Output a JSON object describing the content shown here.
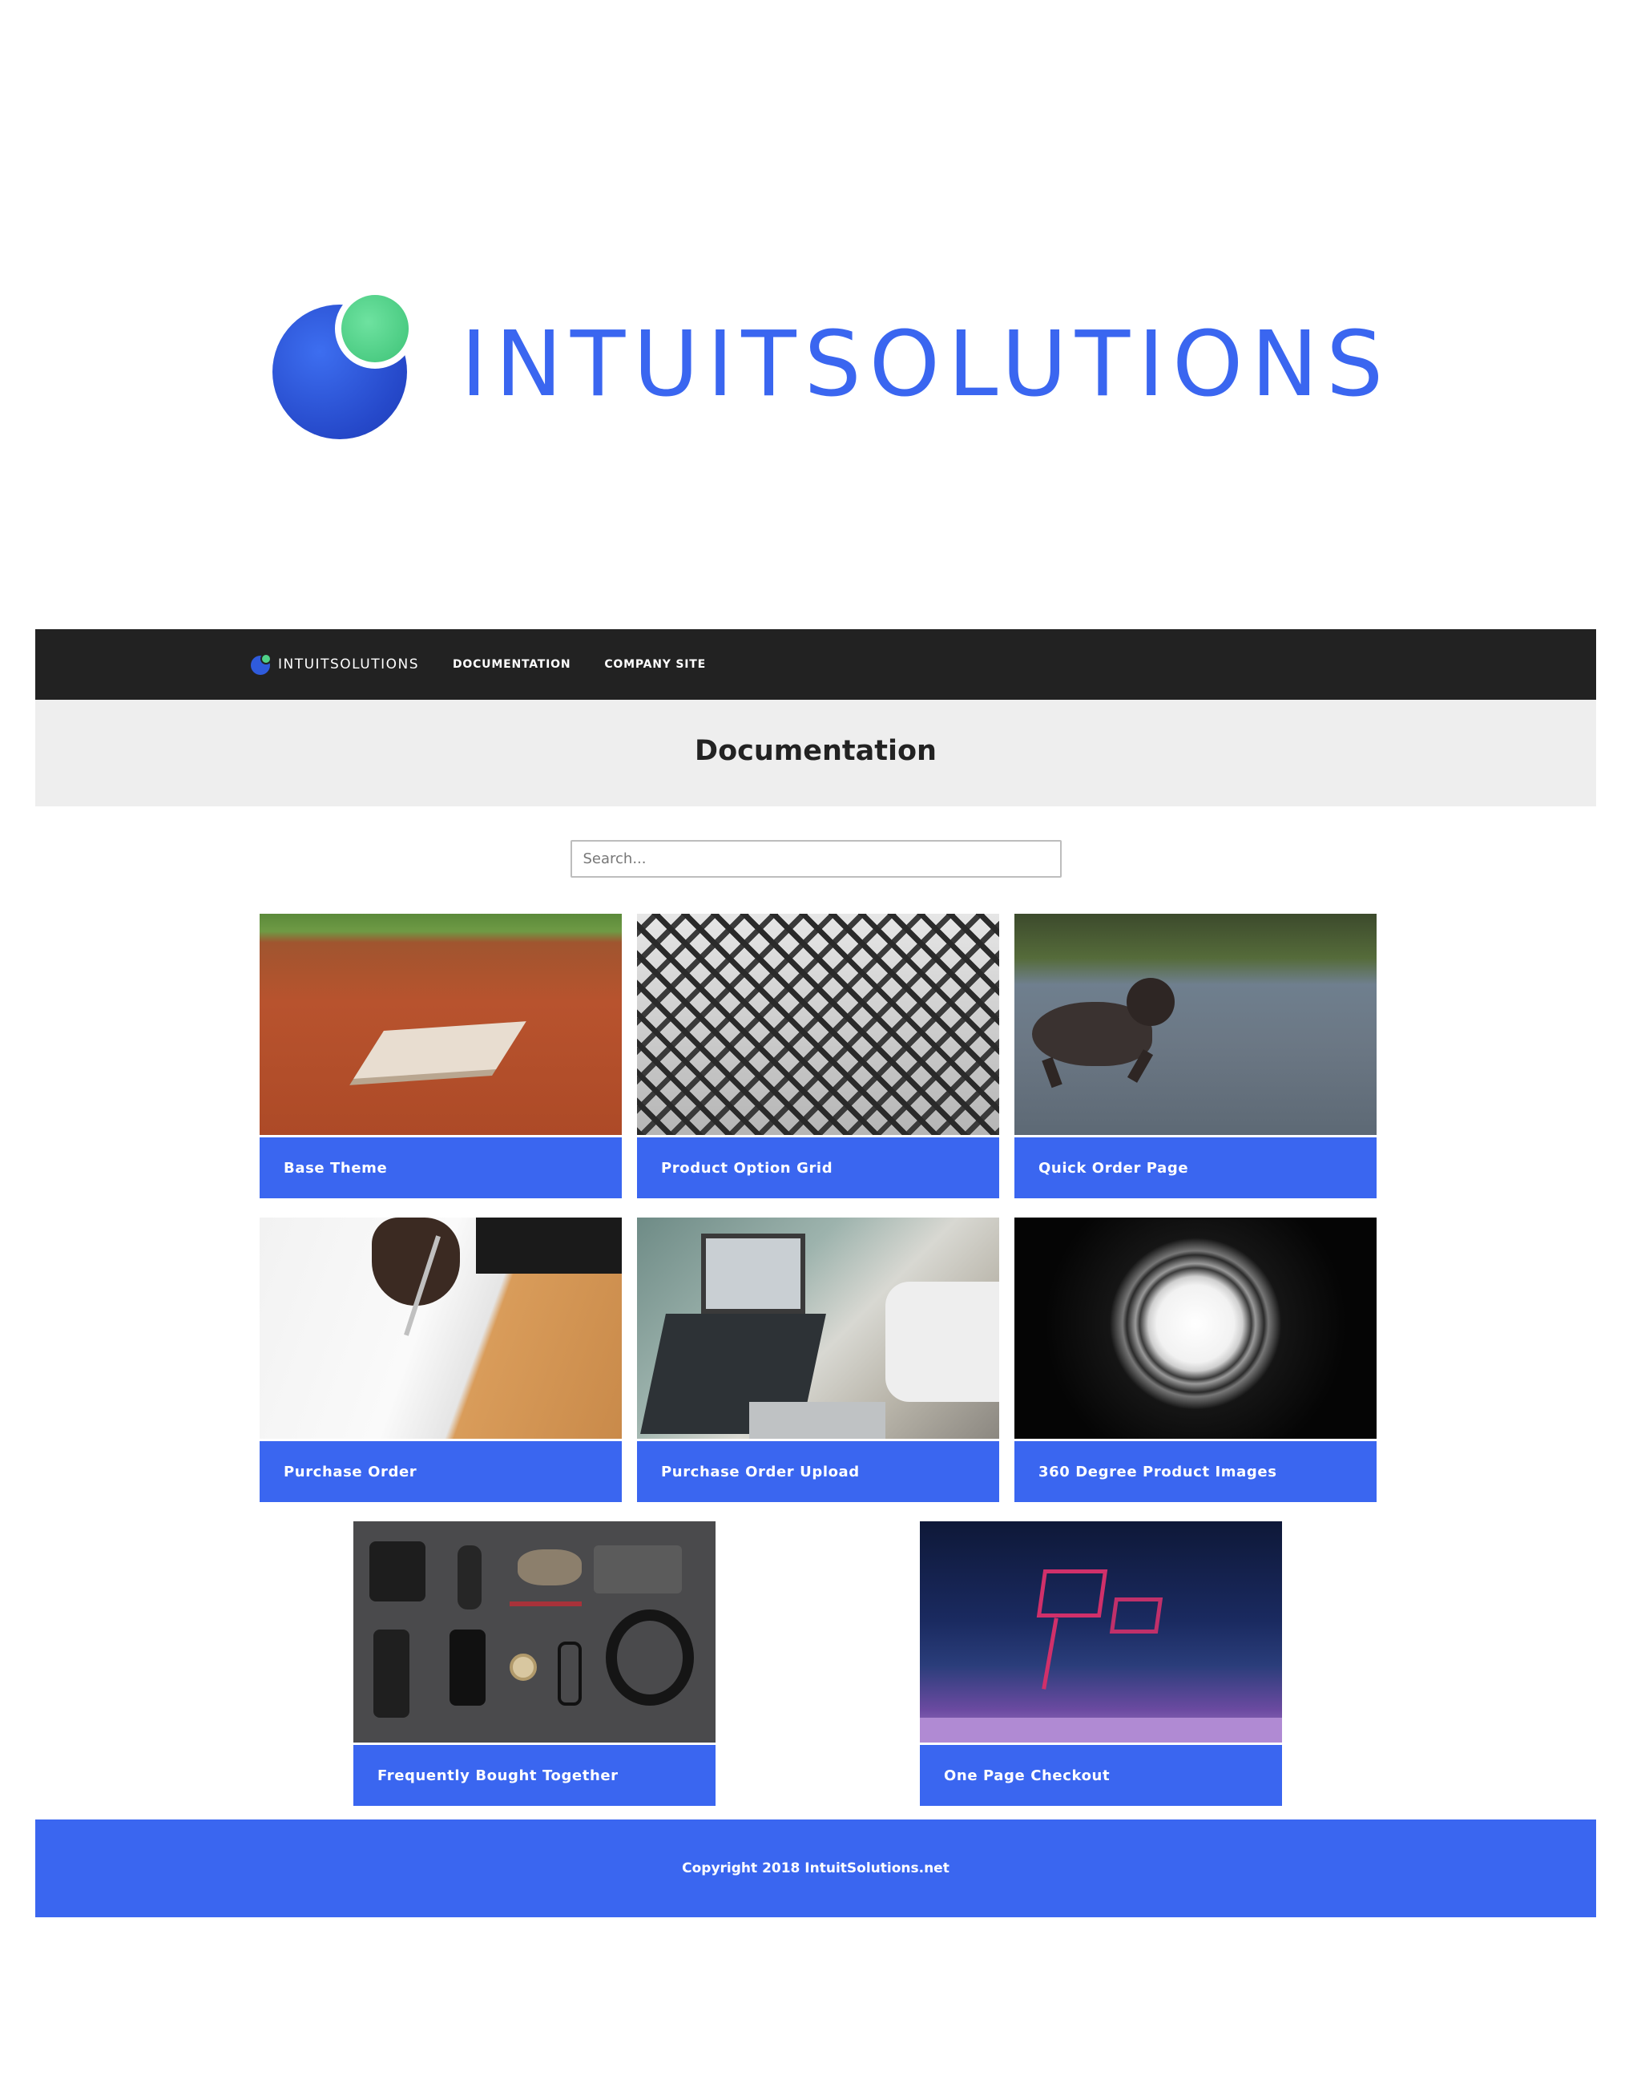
{
  "hero": {
    "wordmark": "INTUITSOLUTIONS"
  },
  "nav": {
    "brand": "INTUITSOLUTIONS",
    "links": [
      "DOCUMENTATION",
      "COMPANY SITE"
    ]
  },
  "page": {
    "title": "Documentation"
  },
  "search": {
    "placeholder": "Search..."
  },
  "cards": [
    {
      "label": "Base Theme",
      "image": "baseball-base-image"
    },
    {
      "label": "Product Option Grid",
      "image": "geometric-grid-image"
    },
    {
      "label": "Quick Order Page",
      "image": "running-dog-image"
    },
    {
      "label": "Purchase Order",
      "image": "signing-document-image"
    },
    {
      "label": "Purchase Order Upload",
      "image": "laptop-paperwork-image"
    },
    {
      "label": "360 Degree Product Images",
      "image": "light-spiral-image"
    },
    {
      "label": "Frequently Bought Together",
      "image": "flatlay-accessories-image"
    },
    {
      "label": "One Page Checkout",
      "image": "shopping-cart-night-image"
    }
  ],
  "footer": {
    "copyright": "Copyright 2018 IntuitSolutions.net"
  },
  "colors": {
    "brand_blue": "#3a66f0",
    "brand_green": "#4fd188",
    "nav_background": "#222222",
    "title_background": "#eeeeee"
  }
}
